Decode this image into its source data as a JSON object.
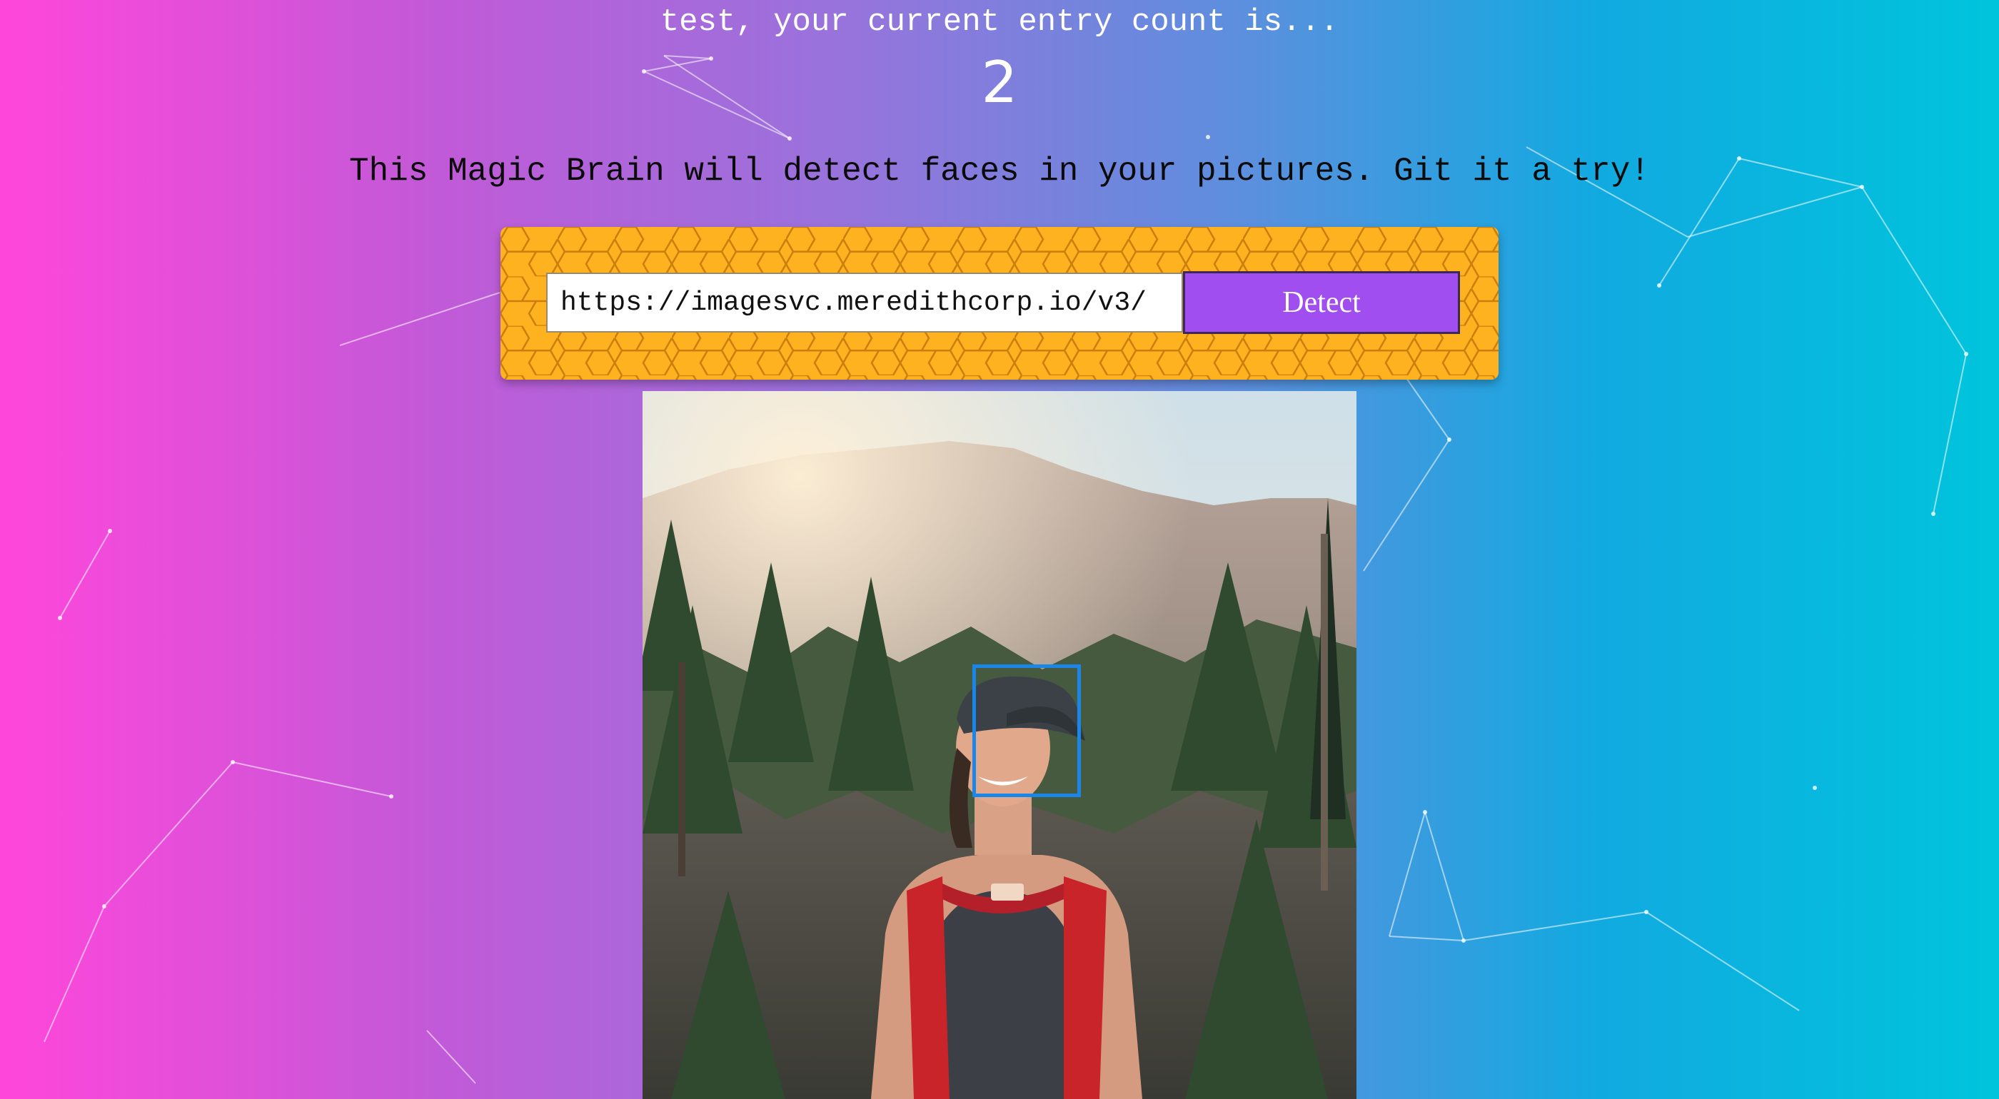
{
  "header": {
    "entry_text": "test, your current entry count is...",
    "entry_count": "2"
  },
  "intro": {
    "text": "This Magic Brain will detect faces in your pictures. Git it a try!"
  },
  "form": {
    "url_value": "https://imagesvc.meredithcorp.io/v3/",
    "detect_label": "Detect"
  },
  "colors": {
    "gradient_left": "#ff46da",
    "gradient_right": "#00c4dc",
    "panel_bg": "#ffb21f",
    "honeycomb_line": "#c97e0d",
    "button_bg": "#a04ef0",
    "face_box": "#1a86e8"
  }
}
